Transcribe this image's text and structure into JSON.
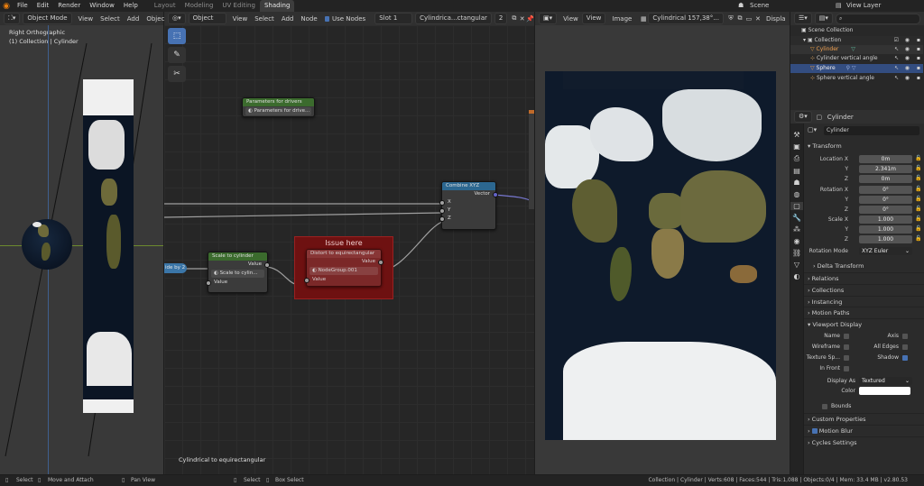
{
  "menu": {
    "items": [
      "File",
      "Edit",
      "Render",
      "Window",
      "Help"
    ],
    "workspaces": [
      "Layout",
      "Modeling",
      "UV Editing",
      "Shading"
    ],
    "active_workspace": "Shading",
    "scene": "Scene",
    "view_layer": "View Layer"
  },
  "viewport": {
    "mode": "Object Mode",
    "menu": [
      "View",
      "Select",
      "Add",
      "Object"
    ],
    "view_name": "Right Orthographic",
    "collection_info": "(1) Collection | Cylinder"
  },
  "node_header": {
    "type": "Object",
    "menu": [
      "View",
      "Select",
      "Add",
      "Node"
    ],
    "use_nodes": "Use Nodes",
    "slot": "Slot 1",
    "material": "Cylindrica...ctangular",
    "users": "2"
  },
  "nodes": {
    "params": {
      "title": "Parameters for drivers",
      "field": "Parameters for drive..."
    },
    "combine": {
      "title": "Combine XYZ",
      "output": "Vector",
      "inputs": [
        "X",
        "Y",
        "Z"
      ]
    },
    "scale": {
      "title": "Scale to cylinder",
      "output": "Value",
      "field": "Scale to cylin...",
      "input": "Value"
    },
    "frame_label": "Issue here",
    "distort": {
      "title": "Distort to equirectangular",
      "output": "Value",
      "field": "NodeGroup.001",
      "input": "Value"
    },
    "reroute": "ide by 2",
    "footer_label": "Cylindrical to equirectangular"
  },
  "image_header": {
    "menu": [
      "View",
      "View",
      "Image"
    ],
    "image_name": "Cylindrical 157,38°...",
    "display": "Displa"
  },
  "outliner": {
    "search_placeholder": "",
    "items": [
      {
        "label": "Scene Collection"
      },
      {
        "label": "Collection"
      },
      {
        "label": "Cylinder"
      },
      {
        "label": "Cylinder vertical angle"
      },
      {
        "label": "Sphere"
      },
      {
        "label": "Sphere vertical angle"
      }
    ]
  },
  "properties": {
    "object_name": "Cylinder",
    "data_name": "Cylinder",
    "transform_title": "Transform",
    "location": {
      "label": "Location X",
      "x": "0m",
      "y": "2.341m",
      "z": "0m"
    },
    "rotation": {
      "label": "Rotation X",
      "x": "0°",
      "y": "0°",
      "z": "0°"
    },
    "scale": {
      "label": "Scale X",
      "x": "1.000",
      "y": "1.000",
      "z": "1.000"
    },
    "axis_y": "Y",
    "axis_z": "Z",
    "rotation_mode_label": "Rotation Mode",
    "rotation_mode": "XYZ Euler",
    "delta_transform": "Delta Transform",
    "relations": "Relations",
    "collections": "Collections",
    "instancing": "Instancing",
    "motion_paths": "Motion Paths",
    "viewport_display": "Viewport Display",
    "display": {
      "name": "Name",
      "axis": "Axis",
      "wireframe": "Wireframe",
      "all_edges": "All Edges",
      "texture_space": "Texture Sp...",
      "shadow": "Shadow",
      "in_front": "In Front",
      "display_as_label": "Display As",
      "display_as": "Textured",
      "color_label": "Color",
      "bounds": "Bounds"
    },
    "custom_properties": "Custom Properties",
    "motion_blur": "Motion Blur",
    "cycles_settings": "Cycles Settings"
  },
  "status": {
    "select": "Select",
    "move": "Move and Attach",
    "pan": "Pan View",
    "select2": "Select",
    "box_select": "Box Select",
    "stats": "Collection | Cylinder | Verts:608 | Faces:544 | Tris:1,088 | Objects:0/4 | Mem: 33.4 MB | v2.80.53"
  },
  "colors": {
    "accent": "#4772b3",
    "frame": "#6e1111",
    "ocean": "#0e1a2b"
  }
}
